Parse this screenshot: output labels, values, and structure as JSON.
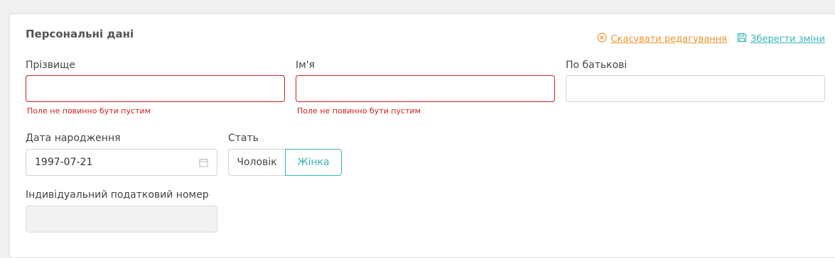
{
  "form": {
    "title": "Персональні дані",
    "cancel_label": "Скасувати редагування",
    "save_label": "Зберегти зміни",
    "surname": {
      "label": "Прізвище",
      "value": "",
      "error": "Поле не повинно бути пустим"
    },
    "first_name": {
      "label": "Ім'я",
      "value": "",
      "error": "Поле не повинно бути пустим"
    },
    "patronymic": {
      "label": "По батькові",
      "value": ""
    },
    "birth_date": {
      "label": "Дата народження",
      "value": "1997-07-21"
    },
    "gender": {
      "label": "Стать",
      "options": [
        "Чоловік",
        "Жінка"
      ],
      "selected": "Жінка"
    },
    "tax_id": {
      "label": "Індивідуальний податковий номер",
      "value": ""
    }
  },
  "colors": {
    "accent": "#36b6b6",
    "cancel": "#e8952e",
    "error": "#cc1f1f"
  },
  "icons": {
    "cancel": "circle-x-icon",
    "save": "floppy-disk-icon",
    "date": "calendar-icon"
  }
}
